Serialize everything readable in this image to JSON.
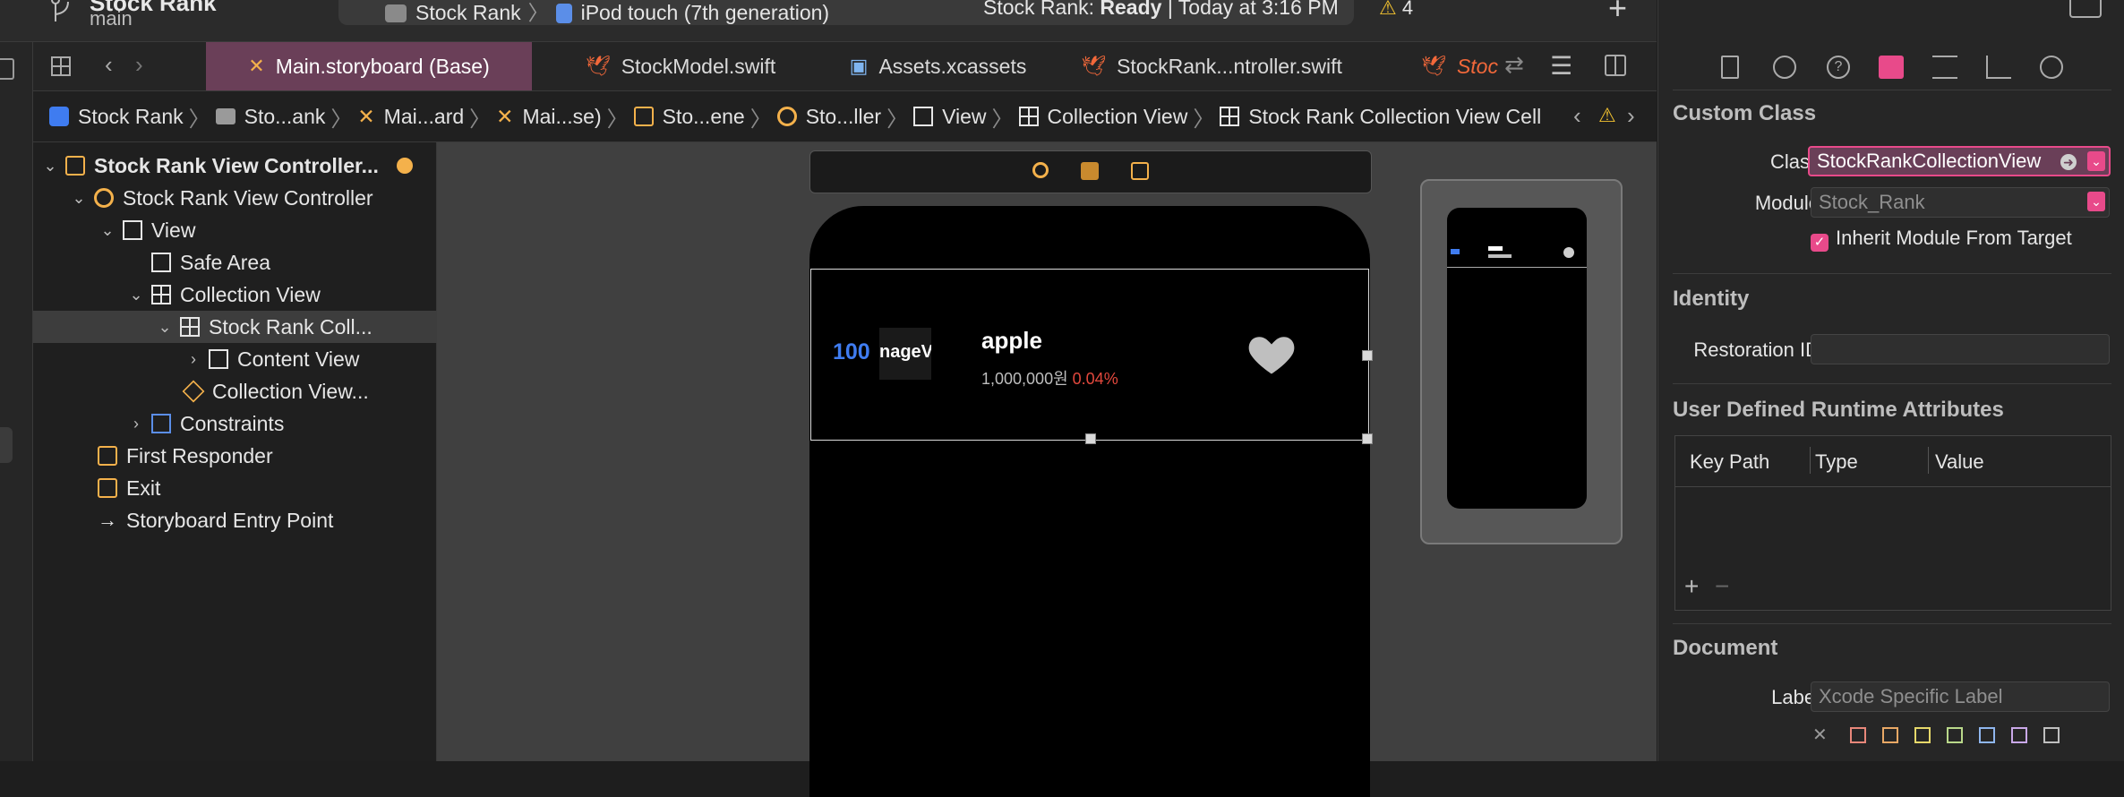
{
  "toolbar": {
    "project_name": "Stock Rank",
    "branch": "main",
    "scheme": "Stock Rank",
    "destination": "iPod touch (7th generation)",
    "status_prefix": "Stock Rank:",
    "status_state": "Ready",
    "status_time": "| Today at 3:16 PM",
    "warning_count": "4"
  },
  "tabs": [
    {
      "label": "Main.storyboard (Base)",
      "icon": "storyboard-icon"
    },
    {
      "label": "StockModel.swift",
      "icon": "swift-icon"
    },
    {
      "label": "Assets.xcassets",
      "icon": "assets-icon"
    },
    {
      "label": "StockRank...ntroller.swift",
      "icon": "swift-icon"
    },
    {
      "label": "Stoc",
      "icon": "swift-icon"
    }
  ],
  "breadcrumbs": [
    "Stock Rank",
    "Sto...ank",
    "Mai...ard",
    "Mai...se)",
    "Sto...ene",
    "Sto...ller",
    "View",
    "Collection View",
    "Stock Rank Collection View Cell"
  ],
  "outline": {
    "items": [
      "Stock Rank View Controller...",
      "Stock Rank View Controller",
      "View",
      "Safe Area",
      "Collection View",
      "Stock Rank Coll...",
      "Content View",
      "Collection View...",
      "Constraints",
      "First Responder",
      "Exit",
      "Storyboard Entry Point"
    ]
  },
  "cell": {
    "rank": "100",
    "image_placeholder": "nageV",
    "name": "apple",
    "price": "1,000,000원",
    "change": "0.04%"
  },
  "inspector": {
    "custom_class": {
      "title": "Custom Class",
      "class_label": "Class",
      "class_value": "StockRankCollectionView",
      "module_label": "Module",
      "module_placeholder": "Stock_Rank",
      "inherit_label": "Inherit Module From Target"
    },
    "identity": {
      "title": "Identity",
      "restoration_label": "Restoration ID"
    },
    "runtime": {
      "title": "User Defined Runtime Attributes",
      "col_key": "Key Path",
      "col_type": "Type",
      "col_value": "Value"
    },
    "document": {
      "title": "Document",
      "label_label": "Label",
      "label_placeholder": "Xcode Specific Label"
    }
  },
  "colors": {
    "accent": "#e84a8a",
    "rank_blue": "#3f7cf0",
    "change_red": "#e2483d"
  }
}
